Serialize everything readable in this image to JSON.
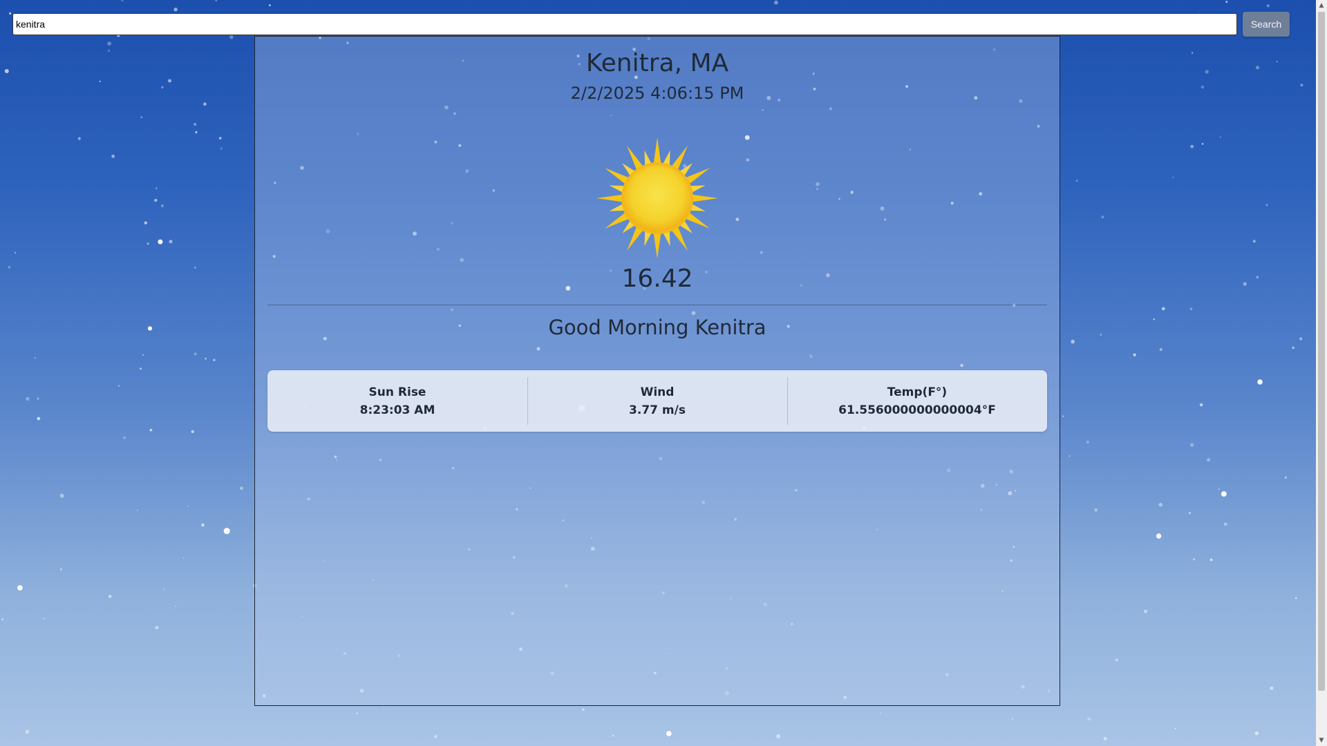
{
  "search": {
    "value": "kenitra",
    "button_label": "Search"
  },
  "weather": {
    "city": "Kenitra, MA",
    "datetime": "2/2/2025 4:06:15 PM",
    "icon": "sun-icon",
    "temperature": "16.42",
    "greeting": "Good Morning Kenitra"
  },
  "stats": [
    {
      "label": "Sun Rise",
      "value": "8:23:03 AM"
    },
    {
      "label": "Wind",
      "value": "3.77 m/s"
    },
    {
      "label": "Temp(F°)",
      "value": "61.556000000000004°F"
    }
  ],
  "colors": {
    "background_top": "#1c4fae",
    "background_bottom": "#a9c4e6",
    "sun": "#f5c518",
    "search_button": "#6e7f97"
  }
}
